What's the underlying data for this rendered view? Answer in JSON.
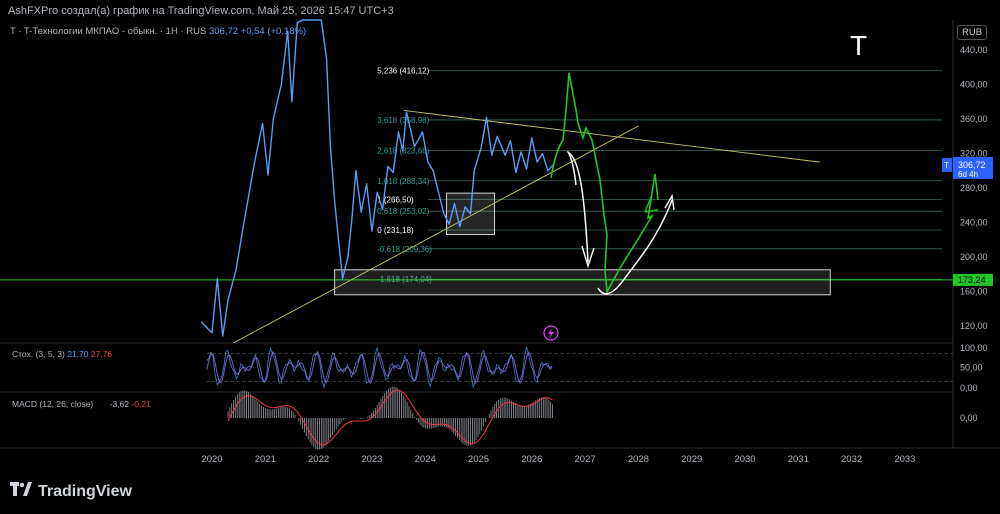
{
  "header": {
    "title": "AshFXPro создал(а) график на TradingView.com, Май 25, 2026 15:47 UTC+3",
    "symbol_prefix": "T · T-Технологии МКПАО - обыкн. · 1H · RUS",
    "price": "306,72",
    "change": "+0,54 (+0,18%)",
    "currency_button": "RUB",
    "ticker_big": "T"
  },
  "brand": {
    "name": "TradingView",
    "logo_icon": "tradingview-logo-icon"
  },
  "colors": {
    "price_line": "#5b9cf6",
    "green": "#1ec81e",
    "fib": "#26a69a",
    "trendline": "#c8c864",
    "stoch_k": "#7e57c2",
    "macd_signal": "#f23645"
  },
  "chart_data": [
    {
      "type": "line",
      "x_labels": [
        "2020",
        "2021",
        "2022",
        "2023",
        "2024",
        "2025",
        "2026",
        "2027",
        "2028",
        "2029",
        "2030",
        "2031",
        "2032",
        "2033"
      ],
      "x_label_years": [
        2020,
        2021,
        2022,
        2023,
        2024,
        2025,
        2026,
        2027,
        2028,
        2029,
        2030,
        2031,
        2032,
        2033
      ],
      "y_ticks": [
        "440,00",
        "400,00",
        "360,00",
        "320,00",
        "280,00",
        "240,00",
        "200,00",
        "160,00",
        "120,00"
      ],
      "y_tick_values": [
        440,
        400,
        360,
        320,
        280,
        240,
        200,
        160,
        120
      ],
      "ylim": [
        100,
        475
      ],
      "series": [
        {
          "points": [
            [
              2019.8,
              125
            ],
            [
              2019.9,
              118
            ],
            [
              2020.0,
              112
            ],
            [
              2020.1,
              175
            ],
            [
              2020.2,
              108
            ],
            [
              2020.3,
              150
            ],
            [
              2020.45,
              185
            ],
            [
              2020.6,
              240
            ],
            [
              2020.8,
              310
            ],
            [
              2020.95,
              355
            ],
            [
              2021.05,
              295
            ],
            [
              2021.15,
              360
            ],
            [
              2021.3,
              400
            ],
            [
              2021.42,
              462
            ],
            [
              2021.5,
              380
            ],
            [
              2021.6,
              472
            ],
            [
              2021.7,
              475
            ],
            [
              2021.9,
              475
            ],
            [
              2022.05,
              475
            ],
            [
              2022.15,
              430
            ],
            [
              2022.22,
              330
            ],
            [
              2022.3,
              265
            ],
            [
              2022.38,
              215
            ],
            [
              2022.45,
              175
            ],
            [
              2022.55,
              200
            ],
            [
              2022.62,
              240
            ],
            [
              2022.7,
              300
            ],
            [
              2022.8,
              252
            ],
            [
              2022.9,
              285
            ],
            [
              2023.0,
              230
            ],
            [
              2023.1,
              275
            ],
            [
              2023.2,
              255
            ],
            [
              2023.3,
              305
            ],
            [
              2023.4,
              298
            ],
            [
              2023.5,
              345
            ],
            [
              2023.58,
              323
            ],
            [
              2023.65,
              368
            ],
            [
              2023.8,
              328
            ],
            [
              2023.95,
              345
            ],
            [
              2024.05,
              310
            ],
            [
              2024.15,
              300
            ],
            [
              2024.25,
              275
            ],
            [
              2024.35,
              250
            ],
            [
              2024.45,
              238
            ],
            [
              2024.55,
              262
            ],
            [
              2024.65,
              235
            ],
            [
              2024.75,
              258
            ],
            [
              2024.85,
              250
            ],
            [
              2024.92,
              300
            ],
            [
              2025.05,
              327
            ],
            [
              2025.15,
              362
            ],
            [
              2025.25,
              318
            ],
            [
              2025.35,
              340
            ],
            [
              2025.5,
              318
            ],
            [
              2025.6,
              335
            ],
            [
              2025.7,
              298
            ],
            [
              2025.8,
              322
            ],
            [
              2025.9,
              302
            ],
            [
              2026.0,
              338
            ],
            [
              2026.1,
              310
            ],
            [
              2026.2,
              320
            ],
            [
              2026.3,
              300
            ],
            [
              2026.4,
              306.72
            ]
          ]
        }
      ],
      "fib_levels": [
        {
          "label": "5,236 (416,12)",
          "value": 416.12
        },
        {
          "label": "3,618 (358,98)",
          "value": 358.98
        },
        {
          "label": "2,618 (323,66)",
          "value": 323.66
        },
        {
          "label": "1,618 (288,34)",
          "value": 288.34
        },
        {
          "label": "1 (266,50)",
          "value": 266.5
        },
        {
          "label": "0,618 (253,02)",
          "value": 253.02
        },
        {
          "label": "0 (231,18)",
          "value": 231.18
        },
        {
          "label": "-0,618 (209,36)",
          "value": 209.36
        },
        {
          "label": "-1,618 (174,04)",
          "value": 174.04
        }
      ],
      "support_level": 173.24,
      "support_label": "173,24",
      "price_label": "306,72",
      "countdown_label": "6d 4h",
      "price_tag_symbol": "T"
    },
    {
      "type": "line",
      "name": "Стох. (3, 5, 3)",
      "k_value": "21,70",
      "d_value": "27,76",
      "y_ticks": [
        "100,00",
        "50,00",
        "0,00"
      ],
      "y_tick_values": [
        100,
        50,
        0
      ],
      "ylim": [
        0,
        100
      ]
    },
    {
      "type": "bar",
      "name": "MACD (12, 26, close)",
      "macd_value": "-3,62",
      "signal_value": "-0,21",
      "y_ticks": [
        "0,00"
      ],
      "y_tick_values": [
        0
      ]
    }
  ]
}
